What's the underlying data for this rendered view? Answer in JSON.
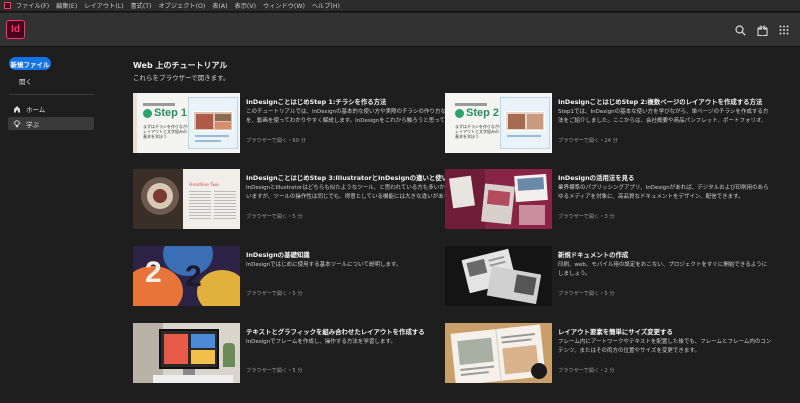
{
  "app": {
    "logo_text": "Id",
    "accent_color": "#ff3366",
    "primary_button_color": "#1473e6"
  },
  "menu": [
    "ファイル(F)",
    "編集(E)",
    "レイアウト(L)",
    "書式(T)",
    "オブジェクト(O)",
    "表(A)",
    "表示(V)",
    "ウィンドウ(W)",
    "ヘルプ(H)"
  ],
  "header": {
    "icons": [
      "search-icon",
      "gift-icon",
      "grid-icon"
    ]
  },
  "sidebar": {
    "new_file": "新規ファイル",
    "open": "開く",
    "nav": [
      {
        "label": "ホーム",
        "icon": "home-icon",
        "active": false
      },
      {
        "label": "学ぶ",
        "icon": "lightbulb-icon",
        "active": true
      }
    ]
  },
  "main": {
    "section_title": "Web 上のチュートリアル",
    "section_subtitle": "これらをブラウザーで開きます。",
    "cards": [
      {
        "title": "InDesignことはじめStep 1:チラシを作る方法",
        "description": "このチュートリアルでは、InDesignの基本的な使い方や実際のチラシの作り方などを、動画を使ってわかりやすく解説します。InDesignをこれから触ろうと思っている方や、InDesignに苦手意識がある方にも、簡単にお使いいただけるようにしています。",
        "meta": "ブラウザーで開く・60 分",
        "thumb": "step1",
        "thumb_text": [
          "Step 1",
          "まずはチラシを作りながら！",
          "レイアウトと文字組みの",
          "基本を学ぼう"
        ]
      },
      {
        "title": "InDesignことはじめStep 2:複数ページのレイアウトを作成する方法",
        "description": "Step1では、InDesignの基本な使い方を学びながら、単ページのチラシを作成する方法をご紹介しました。ここからは、会社概要や商品パンフレット、ポートフォリオ、旅のしおりといった、複数ページを使ったレイアウトを作成していきます。",
        "meta": "ブラウザーで開く・24 分",
        "thumb": "step2",
        "thumb_text": [
          "Step 2",
          "まずはチラシを作りながら！",
          "レイアウトと文字組みの",
          "基本を学ぼう"
        ]
      },
      {
        "title": "InDesignことはじめStep 3:IllustratorとInDesignの違いと使い分け",
        "description": "InDesignとIllustratorはどちらも似たようなツール、と思われている方も多いかと思いますが、ツールの操作性は同じでも、得意としている機能には大きな違いがあります。このステップでは、InDesignとIllustratorそれぞれの特長と使い分けについて解説します。",
        "meta": "ブラウザーで開く・5 分",
        "thumb": "food",
        "thumb_text": [
          "Headline Two"
        ]
      },
      {
        "title": "InDesignの活用法を見る",
        "description": "業界標準のパブリッシングアプリ、InDesignがあれば、デジタルおよび印刷用のあらゆるメディアを対象に、高品質なドキュメントをデザイン、配信できます。",
        "meta": "ブラウザーで開く・3 分",
        "thumb": "books",
        "thumb_text": []
      },
      {
        "title": "InDesignの基礎知識",
        "description": "InDesignではじめに使用する基本ツールについて説明します。",
        "meta": "ブラウザーで開く・5 分",
        "thumb": "art",
        "thumb_text": [
          "2",
          "2"
        ]
      },
      {
        "title": "新規ドキュメントの作成",
        "description": "印刷、web、モバイル用の設定をおこない、プロジェクトをすぐに開始できるようにしましょう。",
        "meta": "ブラウザーで開く・5 分",
        "thumb": "pages",
        "thumb_text": []
      },
      {
        "title": "テキストとグラフィックを組み合わせたレイアウトを作成する",
        "description": "InDesignでフレームを作成し、操作する方法を学習します。",
        "meta": "ブラウザーで開く・5 分",
        "thumb": "desk",
        "thumb_text": []
      },
      {
        "title": "レイアウト要素を簡単にサイズ変更する",
        "description": "フレーム内にアートワークやテキストを配置した後でも、フレームとフレーム内のコンテンツ、またはその両方の位置やサイズを変更できます。",
        "meta": "ブラウザーで開く・2 分",
        "thumb": "book",
        "thumb_text": []
      }
    ]
  }
}
